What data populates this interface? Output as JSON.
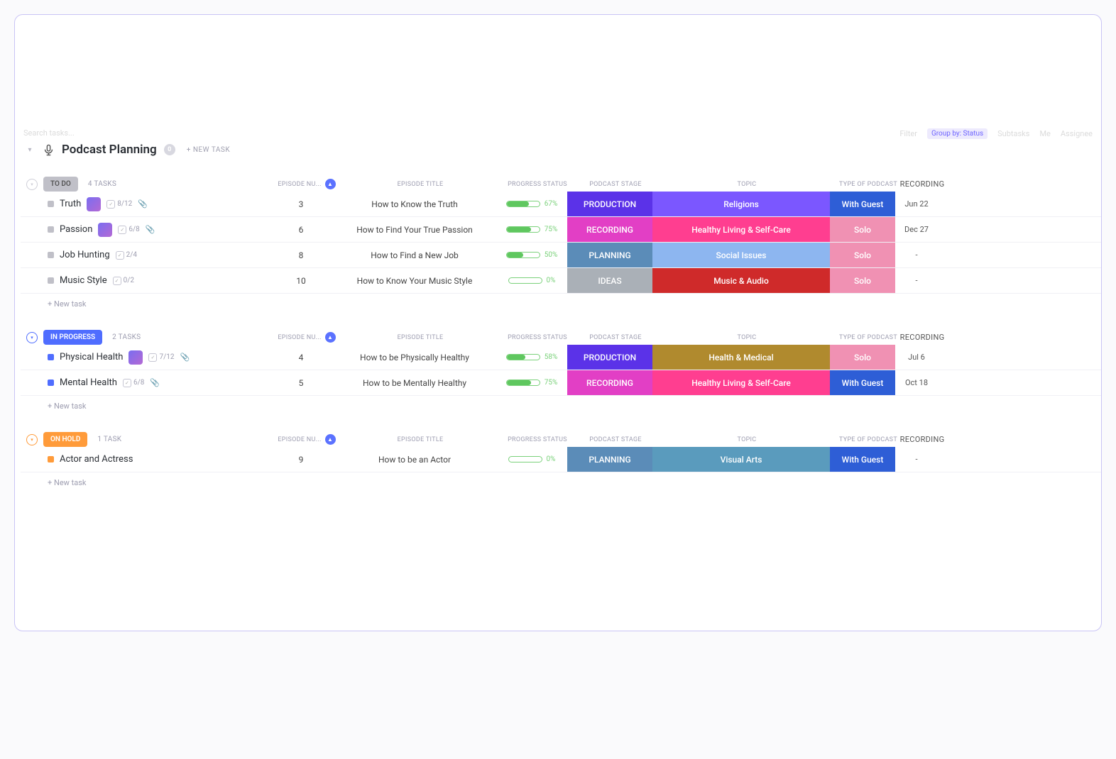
{
  "toolbar": {
    "search_placeholder": "Search tasks...",
    "filter": "Filter",
    "group_by": "Group by: Status",
    "subtasks": "Subtasks",
    "me": "Me",
    "assignee": "Assignee"
  },
  "list": {
    "title": "Podcast Planning",
    "info_count": "0",
    "new_task_label": "+ NEW TASK"
  },
  "columns": {
    "episode_num": "EPISODE NU...",
    "episode_title": "EPISODE TITLE",
    "progress_status": "PROGRESS STATUS",
    "podcast_stage": "PODCAST STAGE",
    "topic": "TOPIC",
    "type_of_podcast": "TYPE OF PODCAST",
    "recording": "RECORDING"
  },
  "groups": [
    {
      "id": "todo",
      "label": "TO DO",
      "count_label": "4 TASKS",
      "color_class": "todo",
      "toggle_class": "gray",
      "square_class": "gray",
      "new_task_label": "+ New task",
      "tasks": [
        {
          "name": "Truth",
          "has_avatar": true,
          "subtasks": "8/12",
          "has_attach": true,
          "ep": "3",
          "title": "How to Know the Truth",
          "pct": 67,
          "stage": "PRODUCTION",
          "stage_class": "tag-production",
          "topic": "Religions",
          "topic_class": "topic-religions",
          "type": "With Guest",
          "type_class": "type-guest",
          "rec": "Jun 22"
        },
        {
          "name": "Passion",
          "has_avatar": true,
          "subtasks": "6/8",
          "has_attach": true,
          "ep": "6",
          "title": "How to Find Your True Passion",
          "pct": 75,
          "stage": "RECORDING",
          "stage_class": "tag-recording",
          "topic": "Healthy Living & Self-Care",
          "topic_class": "topic-healthy",
          "type": "Solo",
          "type_class": "type-solo",
          "rec": "Dec 27"
        },
        {
          "name": "Job Hunting",
          "has_avatar": false,
          "subtasks": "2/4",
          "has_attach": false,
          "ep": "8",
          "title": "How to Find a New Job",
          "pct": 50,
          "stage": "PLANNING",
          "stage_class": "tag-planning",
          "topic": "Social Issues",
          "topic_class": "topic-social",
          "type": "Solo",
          "type_class": "type-solo",
          "rec": "-"
        },
        {
          "name": "Music Style",
          "has_avatar": false,
          "subtasks": "0/2",
          "has_attach": false,
          "ep": "10",
          "title": "How to Know Your Music Style",
          "pct": 0,
          "stage": "IDEAS",
          "stage_class": "tag-ideas",
          "topic": "Music & Audio",
          "topic_class": "topic-music",
          "type": "Solo",
          "type_class": "type-solo",
          "rec": "-"
        }
      ]
    },
    {
      "id": "inprogress",
      "label": "IN PROGRESS",
      "count_label": "2 TASKS",
      "color_class": "inprogress",
      "toggle_class": "blue",
      "square_class": "blue",
      "new_task_label": "+ New task",
      "tasks": [
        {
          "name": "Physical Health",
          "has_avatar": true,
          "subtasks": "7/12",
          "has_attach": true,
          "ep": "4",
          "title": "How to be Physically Healthy",
          "pct": 58,
          "stage": "PRODUCTION",
          "stage_class": "tag-production",
          "topic": "Health & Medical",
          "topic_class": "topic-health",
          "type": "Solo",
          "type_class": "type-solo",
          "rec": "Jul 6"
        },
        {
          "name": "Mental Health",
          "has_avatar": false,
          "subtasks": "6/8",
          "has_attach": true,
          "ep": "5",
          "title": "How to be Mentally Healthy",
          "pct": 75,
          "stage": "RECORDING",
          "stage_class": "tag-recording",
          "topic": "Healthy Living & Self-Care",
          "topic_class": "topic-healthy",
          "type": "With Guest",
          "type_class": "type-guest",
          "rec": "Oct 18"
        }
      ]
    },
    {
      "id": "onhold",
      "label": "ON HOLD",
      "count_label": "1 TASK",
      "color_class": "onhold",
      "toggle_class": "orange",
      "square_class": "orange",
      "new_task_label": "+ New task",
      "tasks": [
        {
          "name": "Actor and Actress",
          "has_avatar": false,
          "subtasks": "",
          "has_attach": false,
          "ep": "9",
          "title": "How to be an Actor",
          "pct": 0,
          "stage": "PLANNING",
          "stage_class": "tag-planning",
          "topic": "Visual Arts",
          "topic_class": "topic-visual",
          "type": "With Guest",
          "type_class": "type-guest",
          "rec": "-"
        }
      ]
    }
  ]
}
